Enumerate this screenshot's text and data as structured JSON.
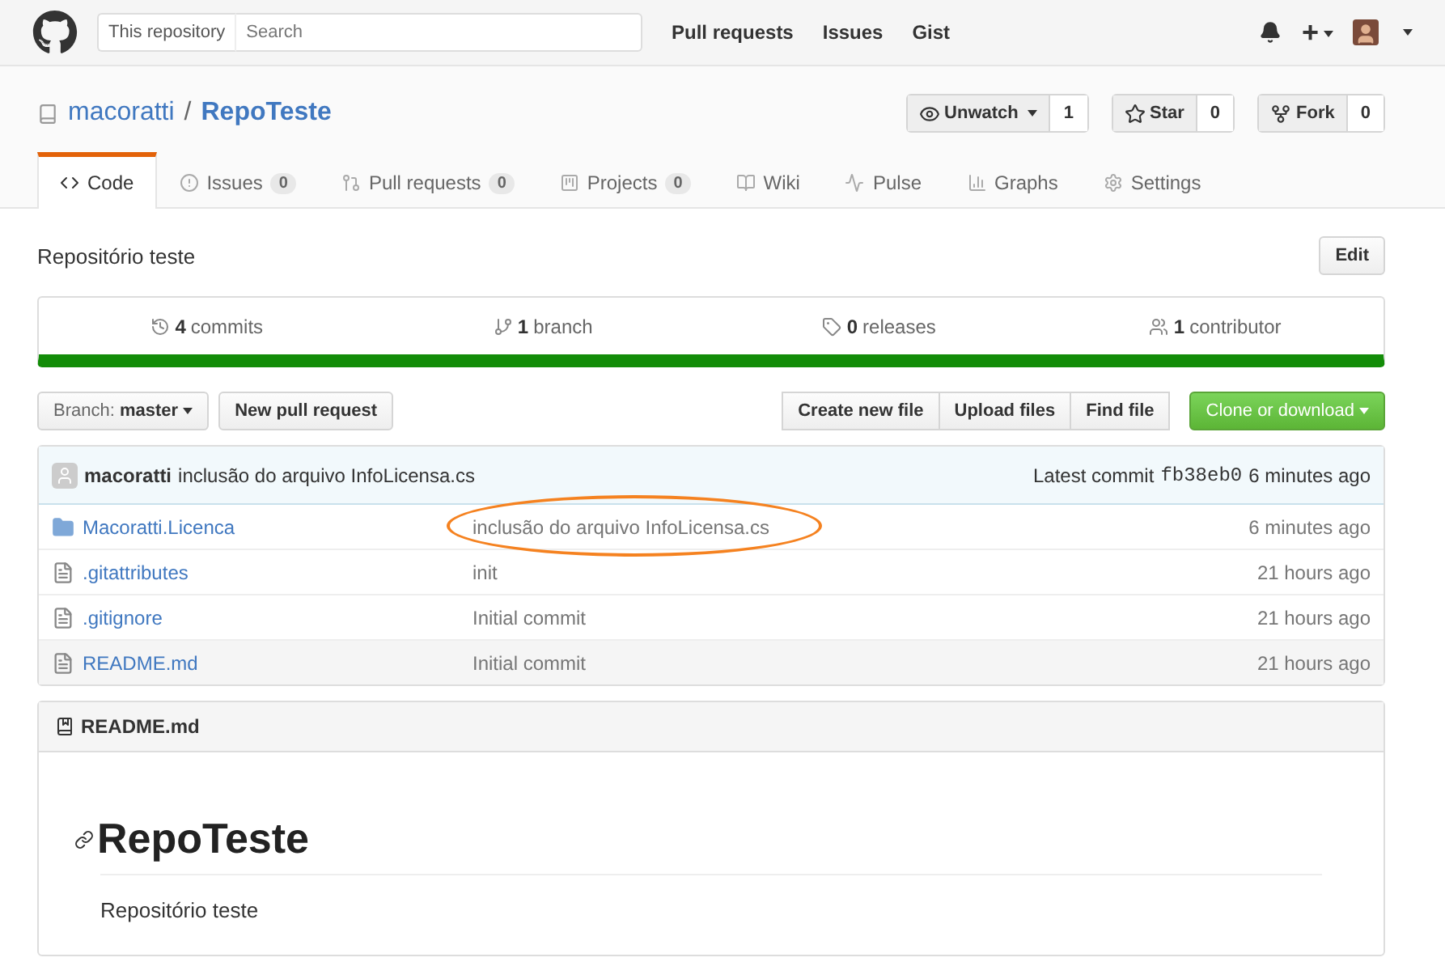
{
  "header": {
    "scope": "This repository",
    "search_placeholder": "Search",
    "nav": [
      "Pull requests",
      "Issues",
      "Gist"
    ],
    "plus": "+"
  },
  "repo": {
    "owner": "macoratti",
    "separator": "/",
    "name": "RepoTeste"
  },
  "actions": [
    {
      "kind": "watch",
      "label": "Unwatch",
      "count": "1"
    },
    {
      "kind": "star",
      "label": "Star",
      "count": "0"
    },
    {
      "kind": "fork",
      "label": "Fork",
      "count": "0"
    }
  ],
  "tabs": [
    {
      "kind": "code",
      "label": "Code",
      "selected": true
    },
    {
      "kind": "issues",
      "label": "Issues",
      "count": "0",
      "selected": false
    },
    {
      "kind": "pulls",
      "label": "Pull requests",
      "count": "0",
      "selected": false
    },
    {
      "kind": "projects",
      "label": "Projects",
      "count": "0",
      "selected": false
    },
    {
      "kind": "wiki",
      "label": "Wiki",
      "selected": false
    },
    {
      "kind": "pulse",
      "label": "Pulse",
      "selected": false
    },
    {
      "kind": "graphs",
      "label": "Graphs",
      "selected": false
    },
    {
      "kind": "settings",
      "label": "Settings",
      "selected": false
    }
  ],
  "description": "Repositório teste",
  "edit_button": "Edit",
  "stats": [
    {
      "kind": "commits",
      "count": "4",
      "label": "commits"
    },
    {
      "kind": "branch",
      "count": "1",
      "label": "branch"
    },
    {
      "kind": "releases",
      "count": "0",
      "label": "releases"
    },
    {
      "kind": "contributors",
      "count": "1",
      "label": "contributor"
    }
  ],
  "branch": {
    "label": "Branch:",
    "value": "master"
  },
  "new_pull_request": "New pull request",
  "file_buttons": [
    "Create new file",
    "Upload files",
    "Find file"
  ],
  "clone_button": "Clone or download",
  "commit": {
    "author": "macoratti",
    "message": "inclusão do arquivo InfoLicensa.cs",
    "latest_label": "Latest commit",
    "sha": "fb38eb0",
    "time": "6 minutes ago"
  },
  "files": [
    {
      "kind": "dir",
      "name": "Macoratti.Licenca",
      "message": "inclusão do arquivo InfoLicensa.cs",
      "time": "6 minutes ago",
      "highlighted": true,
      "hovered": false
    },
    {
      "kind": "file",
      "name": ".gitattributes",
      "message": "init",
      "time": "21 hours ago",
      "highlighted": false,
      "hovered": false
    },
    {
      "kind": "file",
      "name": ".gitignore",
      "message": "Initial commit",
      "time": "21 hours ago",
      "highlighted": false,
      "hovered": false
    },
    {
      "kind": "file",
      "name": "README.md",
      "message": "Initial commit",
      "time": "21 hours ago",
      "highlighted": false,
      "hovered": true
    }
  ],
  "readme": {
    "filename": "README.md",
    "heading": "RepoTeste",
    "text": "Repositório teste"
  }
}
